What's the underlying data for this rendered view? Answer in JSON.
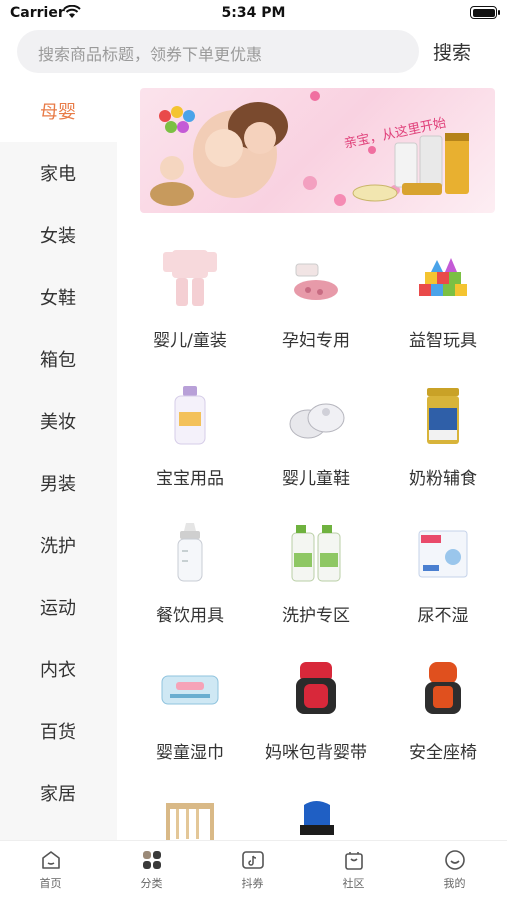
{
  "status": {
    "carrier": "Carrier",
    "time": "5:34 PM"
  },
  "search": {
    "placeholder": "搜索商品标题，领券下单更优惠",
    "button": "搜索"
  },
  "sidebar": {
    "items": [
      {
        "label": "母婴",
        "active": true
      },
      {
        "label": "家电"
      },
      {
        "label": "女装"
      },
      {
        "label": "女鞋"
      },
      {
        "label": "箱包"
      },
      {
        "label": "美妆"
      },
      {
        "label": "男装"
      },
      {
        "label": "洗护"
      },
      {
        "label": "运动"
      },
      {
        "label": "内衣"
      },
      {
        "label": "百货"
      },
      {
        "label": "家居"
      }
    ]
  },
  "banner": {
    "text": "亲宝，从这里开始",
    "image": "mother-baby-banner"
  },
  "categories": [
    {
      "label": "婴儿/童装",
      "icon": "baby-clothes"
    },
    {
      "label": "孕妇专用",
      "icon": "maternity"
    },
    {
      "label": "益智玩具",
      "icon": "toy-blocks"
    },
    {
      "label": "宝宝用品",
      "icon": "baby-lotion"
    },
    {
      "label": "婴儿童鞋",
      "icon": "baby-shoes"
    },
    {
      "label": "奶粉辅食",
      "icon": "milk-powder"
    },
    {
      "label": "餐饮用具",
      "icon": "baby-bottle"
    },
    {
      "label": "洗护专区",
      "icon": "detergent"
    },
    {
      "label": "尿不湿",
      "icon": "diapers"
    },
    {
      "label": "婴童湿巾",
      "icon": "wet-wipes"
    },
    {
      "label": "妈咪包背婴带",
      "icon": "baby-carrier"
    },
    {
      "label": "安全座椅",
      "icon": "car-seat"
    },
    {
      "label": "",
      "icon": "crib"
    },
    {
      "label": "",
      "icon": "stroller"
    }
  ],
  "tabbar": {
    "items": [
      {
        "label": "首页",
        "icon": "home-icon"
      },
      {
        "label": "分类",
        "icon": "category-icon",
        "active": true
      },
      {
        "label": "抖券",
        "icon": "douyin-coupon-icon"
      },
      {
        "label": "社区",
        "icon": "community-icon"
      },
      {
        "label": "我的",
        "icon": "profile-icon"
      }
    ]
  },
  "colors": {
    "accent": "#e87b47",
    "sidebar_bg": "#f7f7f7",
    "search_bg": "#f1f1f3"
  }
}
